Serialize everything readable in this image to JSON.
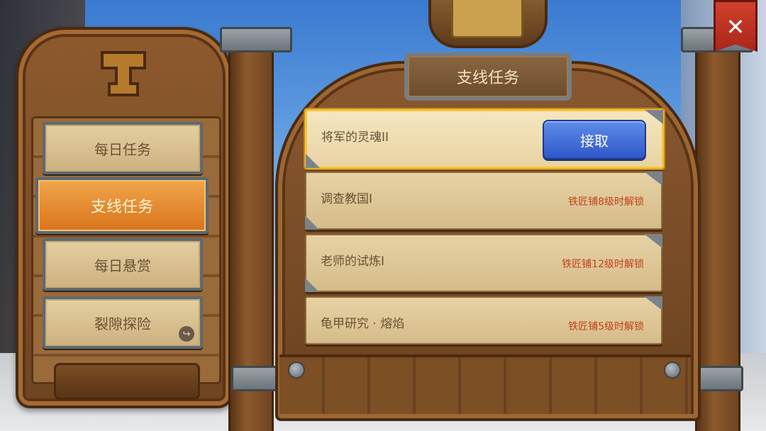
{
  "window": {
    "close_label": "✕"
  },
  "menu": {
    "items": [
      {
        "label": "每日任务",
        "active": false
      },
      {
        "label": "支线任务",
        "active": true
      },
      {
        "label": "每日悬赏",
        "active": false
      },
      {
        "label": "裂隙探险",
        "active": false
      }
    ],
    "share_icon": "↪"
  },
  "panel": {
    "title": "支线任务",
    "quests": [
      {
        "name": "将军的灵魂II",
        "action": "接取",
        "status": ""
      },
      {
        "name": "调查教国I",
        "action": "",
        "status": "铁匠铺8级时解锁"
      },
      {
        "name": "老师的试炼I",
        "action": "",
        "status": "铁匠铺12级时解锁"
      },
      {
        "name": "龟甲研究 · 熔焰",
        "action": "",
        "status": "铁匠铺5级时解锁"
      }
    ]
  },
  "colors": {
    "accent_active": "#d9741c",
    "accept_button": "#2f58c8",
    "lock_text": "#c4421c",
    "selected_border": "#f5c63a"
  }
}
